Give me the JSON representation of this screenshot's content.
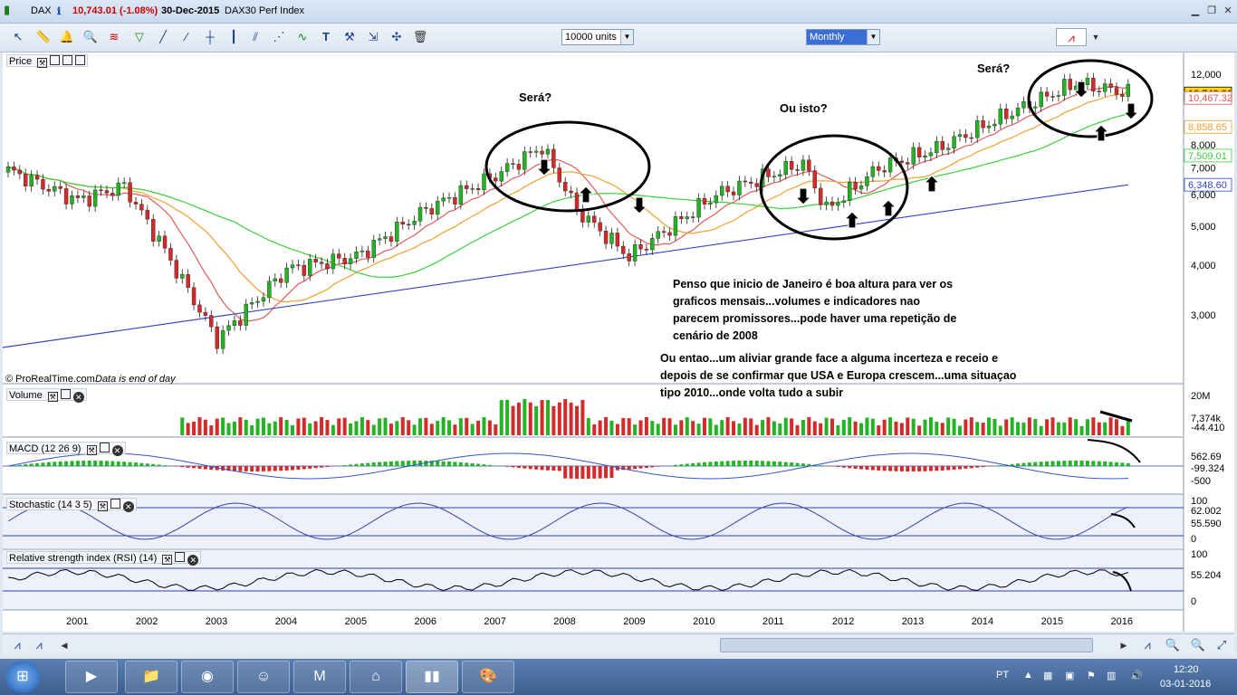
{
  "window": {
    "symbol": "DAX",
    "price_change": "10,743.01 (-1.08%)",
    "date": "30-Dec-2015",
    "index_name": "DAX30 Perf Index"
  },
  "toolbar": {
    "units": "10000 units",
    "timeframe": "Monthly"
  },
  "panels": {
    "price": "Price",
    "volume": "Volume",
    "macd": "MACD (12 26 9)",
    "stochastic": "Stochastic (14 3 5)",
    "rsi": "Relative strength index (RSI) (14)"
  },
  "copyright": "© ProRealTime.com",
  "data_note": "Data is end of day",
  "annotations": {
    "sera1": "Será?",
    "ouisto": "Ou isto?",
    "sera2": "Será?",
    "note1_l1": "Penso que inicio de Janeiro é boa altura para ver os",
    "note1_l2": "graficos mensais...volumes e indicadores nao",
    "note1_l3": "parecem promissores...pode haver uma repetição de",
    "note1_l4": "cenário de 2008",
    "note2_l1": "Ou entao...um aliviar grande face a alguma incerteza e receio e",
    "note2_l2": "depois de se confirmar que USA e Europa crescem...uma situaçao",
    "note2_l3": "tipo 2010...onde volta tudo a subir"
  },
  "axis_labels": {
    "price": [
      "12,000",
      "8,000",
      "7,000",
      "6,000",
      "5,000",
      "4,000",
      "3,000"
    ],
    "price_badges": [
      "10,743.01",
      "10,467.32",
      "8,858.65",
      "7,509.01",
      "6,348.60"
    ],
    "volume": [
      "20M",
      "7,374k",
      "-44.410"
    ],
    "macd": [
      "562.69",
      "-99.324",
      "-500"
    ],
    "stoch": [
      "100",
      "62.002",
      "55.590",
      "0"
    ],
    "rsi": [
      "100",
      "55.204",
      "0"
    ]
  },
  "colors": {
    "up": "#22b422",
    "down": "#d42a2a",
    "ma_red": "#e05a5a",
    "ma_orange": "#f0a030",
    "ma_green": "#3ccf3c",
    "ma_blue": "#3344cc",
    "badge_price": "#ffd700"
  },
  "chart_data": [
    {
      "type": "candlestick",
      "title": "DAX30 Perf Index",
      "x": [
        "2001",
        "2002",
        "2003",
        "2004",
        "2005",
        "2006",
        "2007",
        "2008",
        "2009",
        "2010",
        "2011",
        "2012",
        "2013",
        "2014",
        "2015",
        "2016"
      ],
      "ylim": [
        2200,
        13000
      ],
      "yscale": "log",
      "close_by_year": [
        5200,
        4400,
        2500,
        4000,
        4300,
        5600,
        7100,
        7800,
        4200,
        5900,
        7000,
        5900,
        7600,
        9500,
        10700
      ],
      "last_close": 10743.01,
      "moving_averages": [
        10467.32,
        8858.65,
        7509.01,
        6348.6
      ]
    },
    {
      "type": "bar",
      "title": "Volume",
      "last_values": [
        7374000,
        -44410
      ]
    },
    {
      "type": "line",
      "title": "MACD (12 26 9)",
      "last_values": [
        562.69,
        -99.324
      ]
    },
    {
      "type": "line",
      "title": "Stochastic (14 3 5)",
      "ylim": [
        0,
        100
      ],
      "last_values": [
        62.002,
        55.59
      ]
    },
    {
      "type": "line",
      "title": "Relative strength index (RSI) (14)",
      "ylim": [
        0,
        100
      ],
      "last_values": [
        55.204
      ]
    }
  ],
  "taskbar": {
    "lang": "PT",
    "time": "12:20",
    "date": "03-01-2016"
  }
}
